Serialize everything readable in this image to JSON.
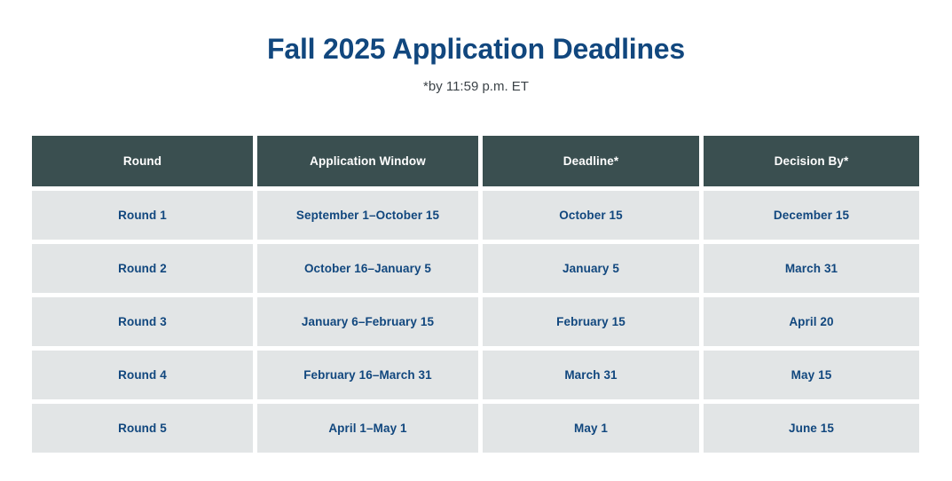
{
  "header": {
    "title": "Fall 2025 Application Deadlines",
    "subtitle": "*by 11:59 p.m. ET"
  },
  "colors": {
    "title_text": "#11477E",
    "subtitle_text": "#3C4348",
    "header_row_bg": "#3A4F50",
    "header_row_text": "#FFFFFF",
    "cell_bg": "#E2E5E6",
    "cell_text": "#11477E",
    "page_bg": "#FFFFFF"
  },
  "table": {
    "columns": [
      "Round",
      "Application Window",
      "Deadline*",
      "Decision By*"
    ],
    "rows": [
      {
        "round": "Round 1",
        "window": "September 1–October 15",
        "deadline": "October 15",
        "decision": "December 15"
      },
      {
        "round": "Round 2",
        "window": "October 16–January 5",
        "deadline": "January 5",
        "decision": "March 31"
      },
      {
        "round": "Round 3",
        "window": "January 6–February 15",
        "deadline": "February 15",
        "decision": "April 20"
      },
      {
        "round": "Round 4",
        "window": "February 16–March 31",
        "deadline": "March 31",
        "decision": "May 15"
      },
      {
        "round": "Round 5",
        "window": "April 1–May 1",
        "deadline": "May 1",
        "decision": "June 15"
      }
    ]
  }
}
